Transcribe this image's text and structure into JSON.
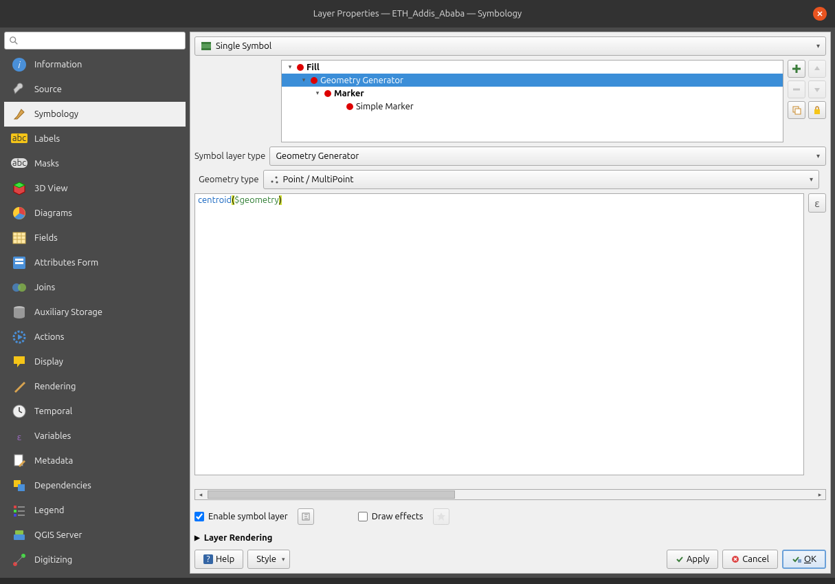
{
  "title": "Layer Properties — ETH_Addis_Ababa — Symbology",
  "search": {
    "placeholder": ""
  },
  "sidebar": {
    "items": [
      {
        "label": "Information"
      },
      {
        "label": "Source"
      },
      {
        "label": "Symbology"
      },
      {
        "label": "Labels"
      },
      {
        "label": "Masks"
      },
      {
        "label": "3D View"
      },
      {
        "label": "Diagrams"
      },
      {
        "label": "Fields"
      },
      {
        "label": "Attributes Form"
      },
      {
        "label": "Joins"
      },
      {
        "label": "Auxiliary Storage"
      },
      {
        "label": "Actions"
      },
      {
        "label": "Display"
      },
      {
        "label": "Rendering"
      },
      {
        "label": "Temporal"
      },
      {
        "label": "Variables"
      },
      {
        "label": "Metadata"
      },
      {
        "label": "Dependencies"
      },
      {
        "label": "Legend"
      },
      {
        "label": "QGIS Server"
      },
      {
        "label": "Digitizing"
      }
    ]
  },
  "renderer": {
    "label": "Single Symbol"
  },
  "tree": {
    "fill": "Fill",
    "geomgen": "Geometry Generator",
    "marker": "Marker",
    "simple": "Simple Marker"
  },
  "symbol_layer_type": {
    "label": "Symbol layer type",
    "value": "Geometry Generator"
  },
  "geometry_type": {
    "label": "Geometry type",
    "value": "Point / MultiPoint"
  },
  "expression": {
    "fn": "centroid",
    "open": "(",
    "var": "$geometry",
    "close": ")"
  },
  "enable_symbol_layer": "Enable symbol layer",
  "draw_effects": "Draw effects",
  "layer_rendering": "Layer Rendering",
  "buttons": {
    "help": "Help",
    "style": "Style",
    "apply": "Apply",
    "cancel": "Cancel",
    "ok": "OK"
  }
}
